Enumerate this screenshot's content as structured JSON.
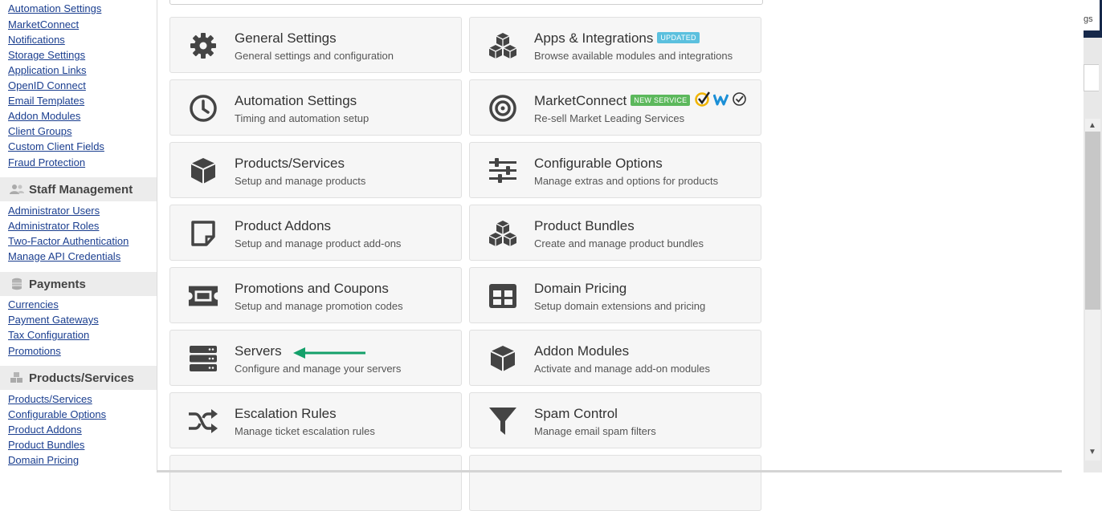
{
  "sidebar": {
    "group1_links": [
      "Automation Settings",
      "MarketConnect",
      "Notifications",
      "Storage Settings",
      "Application Links",
      "OpenID Connect",
      "Email Templates",
      "Addon Modules",
      "Client Groups",
      "Custom Client Fields",
      "Fraud Protection"
    ],
    "staff_heading": "Staff Management",
    "staff_links": [
      "Administrator Users",
      "Administrator Roles",
      "Two-Factor Authentication",
      "Manage API Credentials"
    ],
    "payments_heading": "Payments",
    "payments_links": [
      "Currencies",
      "Payment Gateways",
      "Tax Configuration",
      "Promotions"
    ],
    "products_heading": "Products/Services",
    "products_links": [
      "Products/Services",
      "Configurable Options",
      "Product Addons",
      "Product Bundles",
      "Domain Pricing"
    ]
  },
  "cards": [
    {
      "title": "General Settings",
      "desc": "General settings and configuration",
      "icon": "gear-icon"
    },
    {
      "title": "Apps & Integrations",
      "desc": "Browse available modules and integrations",
      "icon": "cubes-icon",
      "badge": "UPDATED"
    },
    {
      "title": "Automation Settings",
      "desc": "Timing and automation setup",
      "icon": "clock-icon"
    },
    {
      "title": "MarketConnect",
      "desc": "Re-sell Market Leading Services",
      "icon": "target-icon",
      "badge": "NEW SERVICE"
    },
    {
      "title": "Products/Services",
      "desc": "Setup and manage products",
      "icon": "box-icon"
    },
    {
      "title": "Configurable Options",
      "desc": "Manage extras and options for products",
      "icon": "sliders-icon"
    },
    {
      "title": "Product Addons",
      "desc": "Setup and manage product add-ons",
      "icon": "sticky-note-icon"
    },
    {
      "title": "Product Bundles",
      "desc": "Create and manage product bundles",
      "icon": "cubes-icon"
    },
    {
      "title": "Promotions and Coupons",
      "desc": "Setup and manage promotion codes",
      "icon": "ticket-icon"
    },
    {
      "title": "Domain Pricing",
      "desc": "Setup domain extensions and pricing",
      "icon": "table-icon"
    },
    {
      "title": "Servers",
      "desc": "Configure and manage your servers",
      "icon": "server-icon"
    },
    {
      "title": "Addon Modules",
      "desc": "Activate and manage add-on modules",
      "icon": "box-icon"
    },
    {
      "title": "Escalation Rules",
      "desc": "Manage ticket escalation rules",
      "icon": "shuffle-icon"
    },
    {
      "title": "Spam Control",
      "desc": "Manage email spam filters",
      "icon": "filter-icon"
    }
  ],
  "right_edge": {
    "text": "gs"
  },
  "colors": {
    "link": "#1a3e8f",
    "badge_updated": "#5bc0de",
    "badge_new": "#5cb85c",
    "arrow": "#14a06a",
    "icon": "#444444"
  }
}
